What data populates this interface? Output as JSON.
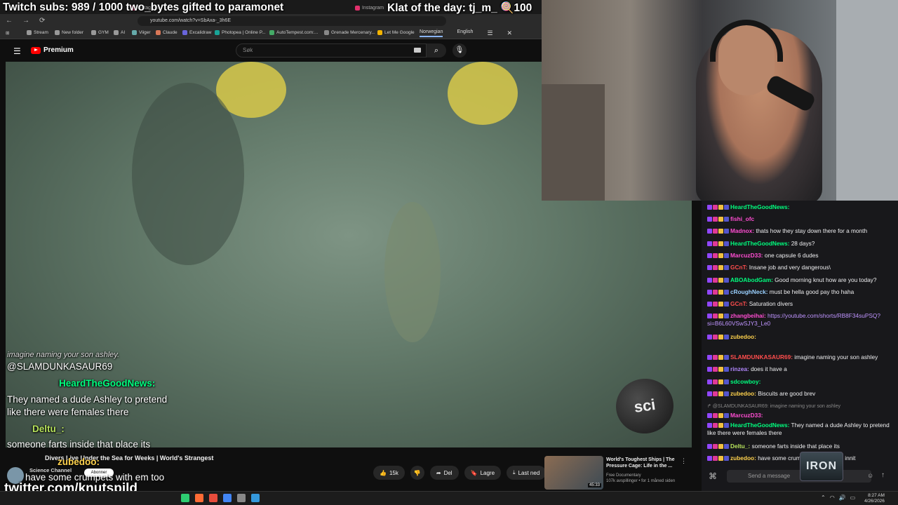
{
  "overlay": {
    "subs_text": "Twitch subs: 989 / 1000   two_bytes gifted to paramonet",
    "klat_text": "Klat of the day: tj_m_ 🍭100"
  },
  "browser": {
    "url": "youtube.com/watch?v=SbAxa-_3h6E",
    "tabs": [
      "Instagram",
      "Instagram"
    ],
    "bookmarks": [
      "Stream",
      "New folder",
      "GYM",
      "AI",
      "Viiger",
      "Claude",
      "Excalidraw",
      "Photopea | Online P...",
      "AutoTempest.com:...",
      "Grenade Mercenary...",
      "Let Me Google"
    ],
    "translate": {
      "lang1": "Norwegian",
      "lang2": "English"
    }
  },
  "youtube": {
    "logo_text": "Premium",
    "search_placeholder": "Søk",
    "video_title": "Divers Live Under the Sea for Weeks | World's Strangest",
    "channel": "Science Channel",
    "subscribe": "Abonner",
    "actions": [
      {
        "icon": "like-icon",
        "label": "15k"
      },
      {
        "icon": "dislike-icon",
        "label": ""
      },
      {
        "icon": "share-icon",
        "label": "Del"
      },
      {
        "icon": "save-icon",
        "label": "Lagre"
      },
      {
        "icon": "download-icon",
        "label": "Last ned"
      }
    ],
    "recommended": {
      "title": "World's Toughest Ships | The Pressure Cage: Life in the ...",
      "channel": "Free Documentary",
      "meta": "107k avspillinger • for 1 måned siden",
      "duration": "45:33"
    },
    "logo_watermark": "sci"
  },
  "video_chat": {
    "line1": "imagine naming your son ashley.",
    "line2": "@SLAMDUNKASAUR69",
    "user1": "HeardTheGoodNews:",
    "line3": "They named a dude Ashley to pretend",
    "line4": "like there were females there",
    "user2": "Deltu_:",
    "line5": "someone farts inside that place its",
    "user3": "zubedoo:",
    "line6": "have some crumpets with em too"
  },
  "twitter_handle": "twitter.com/knutspild",
  "chat": {
    "input_placeholder": "Send a message",
    "messages": [
      {
        "user": "HeardTheGoodNews:",
        "text": "",
        "color": "#00ff7f"
      },
      {
        "user": "fishi_ofc",
        "text": "",
        "color": "#ff4dd2"
      },
      {
        "user": "Madnox:",
        "text": "thats how they stay down there for a month",
        "color": "#ff4dd2"
      },
      {
        "user": "HeardTheGoodNews:",
        "text": "28 days?",
        "color": "#00ff7f"
      },
      {
        "user": "MarcuzD33:",
        "text": "one capsule 6 dudes",
        "color": "#ff4dd2"
      },
      {
        "user": "GCnT:",
        "text": "Insane job and very dangerous\\",
        "color": "#ff4d4d"
      },
      {
        "user": "ABOAbodGam:",
        "text": "Good morning knut how are you today?",
        "color": "#00ff7f"
      },
      {
        "user": "cRoughNeck:",
        "text": "must be hella good pay tho haha",
        "color": "#9ad0ff"
      },
      {
        "user": "GCnT:",
        "text": "Saturation divers",
        "color": "#ff4d4d"
      },
      {
        "user": "zhangbeihai:",
        "text": "https://youtube.com/shorts/RB8F34suPSQ?si=B6L60VSwSJY3_Le0",
        "color": "#ff4dd2"
      },
      {
        "user": "zubedoo:",
        "text": "",
        "color": "#ffd24d"
      },
      {
        "user": "SLAMDUNKASAUR69:",
        "text": "imagine naming your son ashley",
        "color": "#ff4d4d"
      },
      {
        "user": "rinzea:",
        "text": "does it have a",
        "color": "#b388ff"
      },
      {
        "user": "sdcowboy:",
        "text": "",
        "color": "#00ff7f"
      },
      {
        "user": "zubedoo:",
        "text": "Biscuits are good brev",
        "color": "#ffd24d"
      },
      {
        "user": "",
        "text": "↱ @SLAMDUNKASAUR69: imagine naming your son ashley",
        "color": "#888888"
      },
      {
        "user": "MarcuzD33:",
        "text": "",
        "color": "#ff4dd2"
      },
      {
        "user": "HeardTheGoodNews:",
        "text": "They named a dude Ashley to pretend like there were females there",
        "color": "#00ff7f"
      },
      {
        "user": "Deltu_:",
        "text": "someone farts inside that place its",
        "color": "#b7e35c"
      },
      {
        "user": "zubedoo:",
        "text": "have some crumpets with em too innit",
        "color": "#ffd24d"
      }
    ],
    "iron_logo": "IRON"
  },
  "taskbar": {
    "time": "8:27 AM",
    "date": "4/26/2026"
  }
}
